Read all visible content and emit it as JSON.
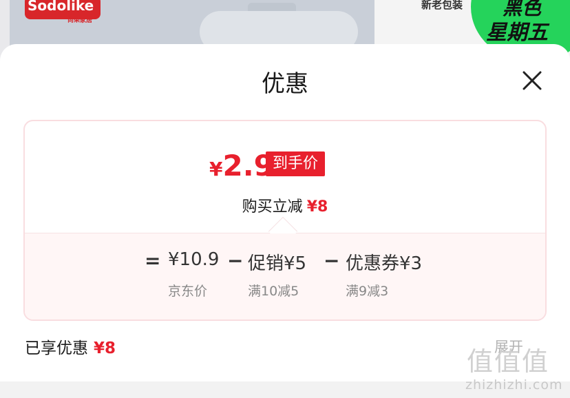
{
  "background": {
    "brand_logo": "Sodolike",
    "brand_sub": "尚朵家居",
    "promo_small": "新老包装",
    "promo_line1": "黑色",
    "promo_line2": "星期五"
  },
  "sheet": {
    "title": "优惠",
    "close_icon": "close-icon"
  },
  "price_card": {
    "currency": "¥",
    "final_price": "2.9",
    "final_price_label": "到手价",
    "instant_cut_label": "购买立减",
    "instant_cut_amount": "¥8",
    "equals": "=",
    "minus": "−",
    "breakdown": [
      {
        "amount": "¥10.9",
        "caption": "京东价"
      },
      {
        "amount": "促销¥5",
        "caption": "满10减5"
      },
      {
        "amount": "优惠券¥3",
        "caption": "满9减3"
      }
    ]
  },
  "summary": {
    "enjoyed_label": "已享优惠",
    "enjoyed_amount": "¥8",
    "expand_label": "展开"
  },
  "watermark": {
    "logo": "值值值",
    "site": "zhizhizhi.com"
  },
  "colors": {
    "accent": "#e8202d",
    "card_border": "#f9dde0",
    "card_lower_bg": "#fff6f6"
  }
}
